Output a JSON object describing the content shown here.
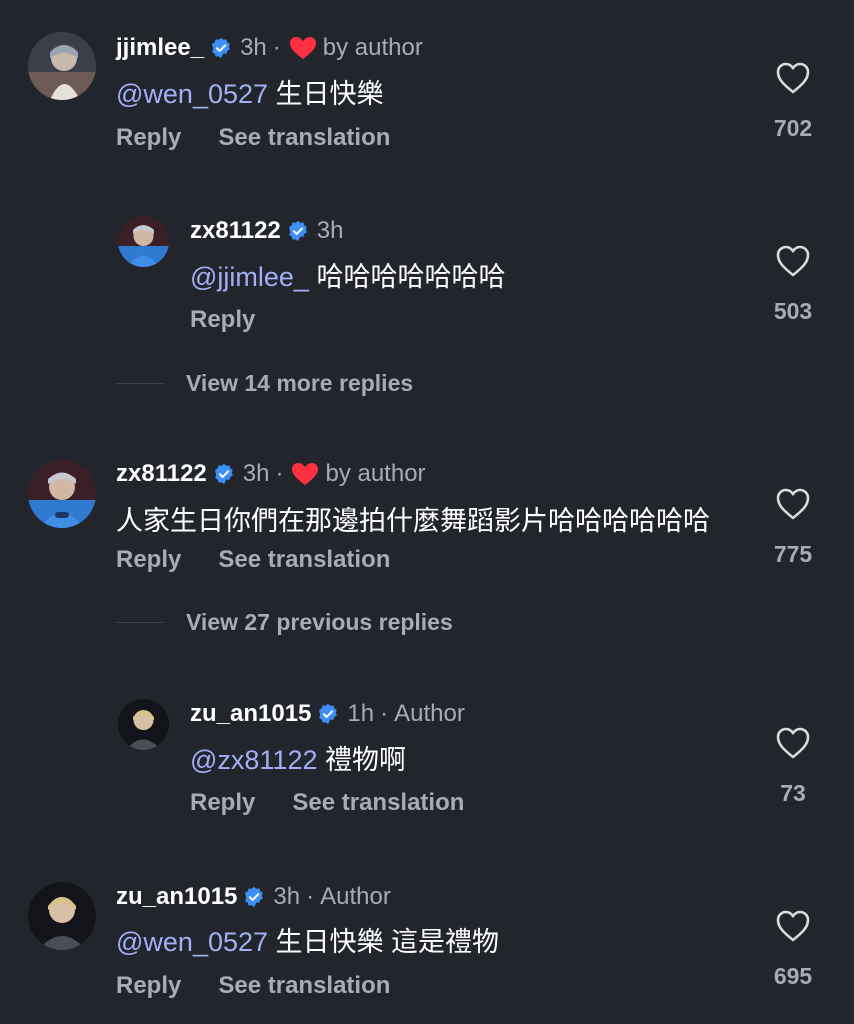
{
  "accent_colors": {
    "mention": "#a3aff5",
    "verified": "#3d8ff5",
    "heart": "#ff3040",
    "muted_text": "#a8acb3",
    "background": "#22262c"
  },
  "comments": [
    {
      "username": "jjimlee_",
      "time": "3h",
      "badge": "by author",
      "mention": "@wen_0527",
      "text": "生日快樂",
      "reply_label": "Reply",
      "translate_label": "See translation",
      "likes": "702"
    },
    {
      "username": "zx81122",
      "time": "3h",
      "mention": "@jjimlee_",
      "text": "哈哈哈哈哈哈哈",
      "reply_label": "Reply",
      "likes": "503"
    },
    {
      "username": "zx81122",
      "time": "3h",
      "badge": "by author",
      "text": "人家生日你們在那邊拍什麼舞蹈影片哈哈哈哈哈哈",
      "reply_label": "Reply",
      "translate_label": "See translation",
      "likes": "775"
    },
    {
      "username": "zu_an1015",
      "time": "1h",
      "role": "Author",
      "mention": "@zx81122",
      "text": "禮物啊",
      "reply_label": "Reply",
      "translate_label": "See translation",
      "likes": "73"
    },
    {
      "username": "zu_an1015",
      "time": "3h",
      "role": "Author",
      "mention": "@wen_0527",
      "text": "生日快樂 這是禮物",
      "reply_label": "Reply",
      "translate_label": "See translation",
      "likes": "695"
    }
  ],
  "view_more_1": "View 14 more replies",
  "view_more_2": "View 27 previous replies",
  "separator": "·",
  "icons": {
    "verified": "verified-badge-icon",
    "heart_filled": "heart-filled-icon",
    "heart_outline": "heart-outline-icon"
  }
}
